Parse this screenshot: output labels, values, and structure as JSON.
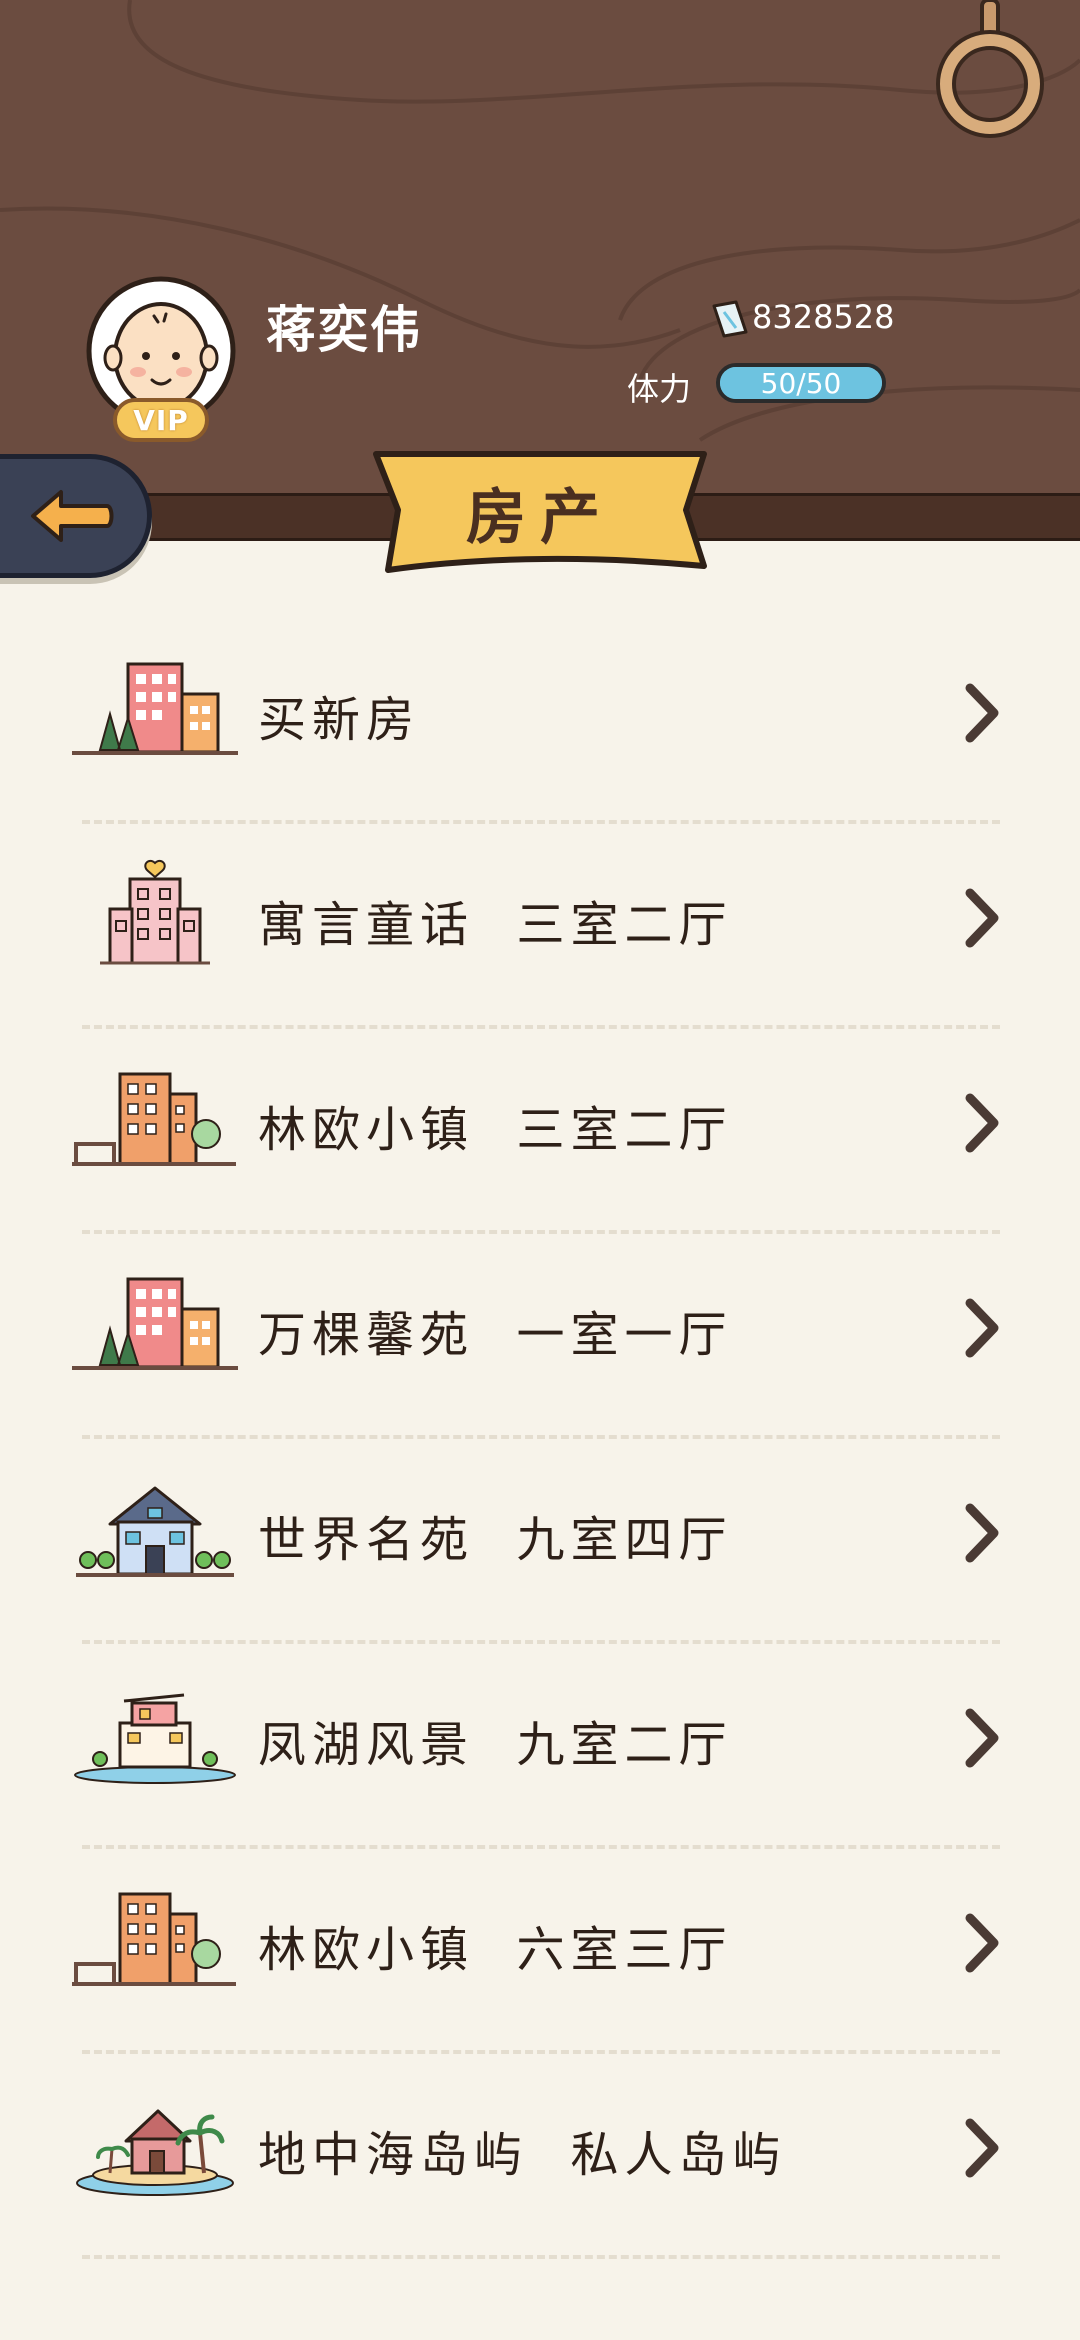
{
  "player": {
    "name": "蒋奕伟",
    "vip_label": "VIP",
    "money": "8328528",
    "stamina_label": "体力",
    "stamina_text": "50/50",
    "stamina_fraction": 1.0
  },
  "page": {
    "title": "房产"
  },
  "properties": [
    {
      "label": "买新房",
      "icon": "new-house-icon"
    },
    {
      "label": "寓言童话  三室二厅",
      "icon": "pink-apartment-icon"
    },
    {
      "label": "林欧小镇  三室二厅",
      "icon": "orange-apartment-icon"
    },
    {
      "label": "万棵馨苑  一室一厅",
      "icon": "new-house-icon"
    },
    {
      "label": "世界名苑  九室四厅",
      "icon": "blue-house-icon"
    },
    {
      "label": "凤湖风景  九室二厅",
      "icon": "lake-villa-icon"
    },
    {
      "label": "林欧小镇  六室三厅",
      "icon": "orange-apartment-icon"
    },
    {
      "label": "地中海岛屿  私人岛屿",
      "icon": "island-icon"
    }
  ],
  "colors": {
    "header_wood": "#6b4c40",
    "background": "#f7f3ea",
    "banner": "#f5c75c",
    "stamina": "#6dc3e0",
    "back_button": "#3a4155"
  }
}
